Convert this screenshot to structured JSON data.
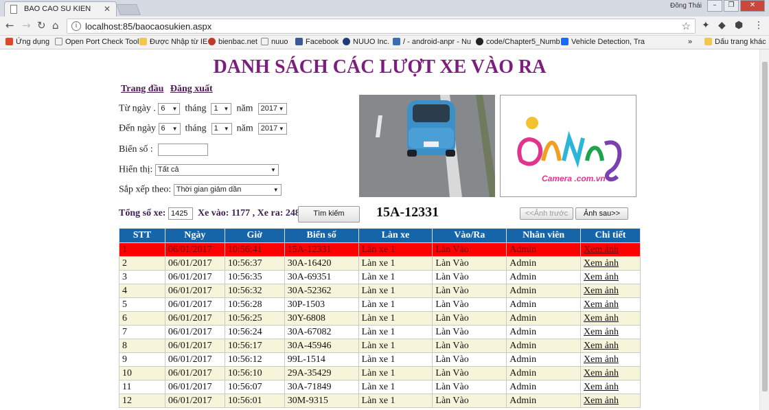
{
  "browser": {
    "tab_title": "BAO CAO SU KIEN",
    "user": "Đông Thái",
    "url": "localhost:85/baocaosukien.aspx",
    "bookmarks": [
      {
        "label": "Ứng dụng",
        "color": "#e0442a"
      },
      {
        "label": "Open Port Check Tool",
        "color": "#ffffff"
      },
      {
        "label": "Được Nhập từ IE",
        "color": "#f3c74a"
      },
      {
        "label": "bienbac.net",
        "color": "#c0392b"
      },
      {
        "label": "nuuo",
        "color": "#ffffff"
      },
      {
        "label": "Facebook",
        "color": "#3b5998"
      },
      {
        "label": "NUUO Inc.",
        "color": "#1e3a7a"
      },
      {
        "label": "/ - android-anpr - Nu",
        "color": "#3a6fb0"
      },
      {
        "label": "code/Chapter5_Numb",
        "color": "#222222"
      },
      {
        "label": "Vehicle Detection, Tra",
        "color": "#1769ff"
      }
    ],
    "bookmarks_more": "»",
    "other_bookmarks": "Dấu trang khác"
  },
  "page": {
    "title": "DANH SÁCH CÁC LƯỢT XE VÀO RA",
    "links": {
      "home": "Trang đầu",
      "logout": "Đăng xuất"
    },
    "from_label": "Từ ngày .",
    "to_label": "Đến ngày",
    "month_label": "tháng",
    "year_label": "năm",
    "from": {
      "day": "6",
      "month": "1",
      "year": "2017"
    },
    "to": {
      "day": "6",
      "month": "1",
      "year": "2017"
    },
    "plate_label": "Biển số :",
    "plate_value": "",
    "display_label": "Hiển thị:",
    "display_value": "Tất cả",
    "sort_label": "Sắp xếp theo:",
    "sort_value": "Thời gian giảm dần",
    "total_label": "Tổng số xe:",
    "total_value": "1425",
    "in_out_text": "Xe vào: 1177 , Xe ra: 248",
    "search_button": "Tìm kiếm",
    "selected_plate": "15A-12331",
    "prev_button": "<<Ảnh trước",
    "next_button": "Ảnh sau>>",
    "photo_plate": "15A-12331",
    "logo_text": "DaNang",
    "logo_sub": "Camera .com.vn"
  },
  "table": {
    "headers": [
      "STT",
      "Ngày",
      "Giờ",
      "Biển số",
      "Làn xe",
      "Vào/Ra",
      "Nhân viên",
      "Chi tiết"
    ],
    "rows": [
      [
        "1",
        "06/01/2017",
        "10:56:41",
        "15A-12331",
        "Làn xe 1",
        "Làn Vào",
        "Admin",
        "Xem ảnh"
      ],
      [
        "2",
        "06/01/2017",
        "10:56:37",
        "30A-16420",
        "Làn xe 1",
        "Làn Vào",
        "Admin",
        "Xem ảnh"
      ],
      [
        "3",
        "06/01/2017",
        "10:56:35",
        "30A-69351",
        "Làn xe 1",
        "Làn Vào",
        "Admin",
        "Xem ảnh"
      ],
      [
        "4",
        "06/01/2017",
        "10:56:32",
        "30A-52362",
        "Làn xe 1",
        "Làn Vào",
        "Admin",
        "Xem ảnh"
      ],
      [
        "5",
        "06/01/2017",
        "10:56:28",
        "30P-1503",
        "Làn xe 1",
        "Làn Vào",
        "Admin",
        "Xem ảnh"
      ],
      [
        "6",
        "06/01/2017",
        "10:56:25",
        "30Y-6808",
        "Làn xe 1",
        "Làn Vào",
        "Admin",
        "Xem ảnh"
      ],
      [
        "7",
        "06/01/2017",
        "10:56:24",
        "30A-67082",
        "Làn xe 1",
        "Làn Vào",
        "Admin",
        "Xem ảnh"
      ],
      [
        "8",
        "06/01/2017",
        "10:56:17",
        "30A-45946",
        "Làn xe 1",
        "Làn Vào",
        "Admin",
        "Xem ảnh"
      ],
      [
        "9",
        "06/01/2017",
        "10:56:12",
        "99L-1514",
        "Làn xe 1",
        "Làn Vào",
        "Admin",
        "Xem ảnh"
      ],
      [
        "10",
        "06/01/2017",
        "10:56:10",
        "29A-35429",
        "Làn xe 1",
        "Làn Vào",
        "Admin",
        "Xem ảnh"
      ],
      [
        "11",
        "06/01/2017",
        "10:56:07",
        "30A-71849",
        "Làn xe 1",
        "Làn Vào",
        "Admin",
        "Xem ảnh"
      ],
      [
        "12",
        "06/01/2017",
        "10:56:01",
        "30M-9315",
        "Làn xe 1",
        "Làn Vào",
        "Admin",
        "Xem ảnh"
      ]
    ],
    "selected_row": 0
  },
  "colors": {
    "title": "#7b1e7d",
    "header_bg": "#1565a8",
    "selected_row": "#ff0000",
    "alt_row": "#f7f5d9"
  }
}
